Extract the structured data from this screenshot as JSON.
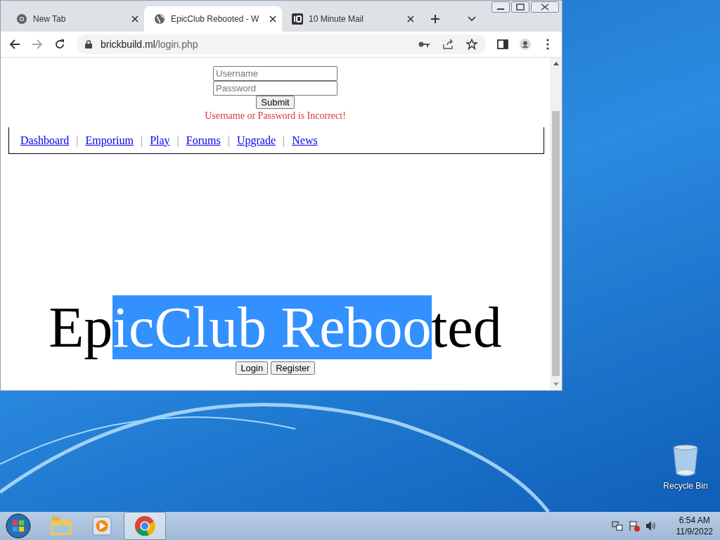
{
  "tabs": [
    {
      "title": "New Tab",
      "kind": "chrome",
      "selected": false
    },
    {
      "title": "EpicClub Rebooted - W",
      "kind": "globe",
      "selected": true
    },
    {
      "title": "10 Minute Mail",
      "kind": "ten",
      "selected": false
    }
  ],
  "address": {
    "host": "brickbuild.ml",
    "path": "/login.php"
  },
  "login_form": {
    "username_placeholder": "Username",
    "password_placeholder": "Password",
    "submit": "Submit",
    "error": "Username or Password is Incorrect!"
  },
  "nav_links": [
    "Dashboard",
    "Emporium",
    "Play",
    "Forums",
    "Upgrade",
    "News"
  ],
  "nav_separator": "|",
  "site_title": [
    {
      "text": "Ep",
      "selected": false
    },
    {
      "text": "icClub Reboo",
      "selected": true
    },
    {
      "text": "ted",
      "selected": false
    }
  ],
  "auth_buttons": [
    "Login",
    "Register"
  ],
  "desktop_icons": [
    {
      "label": "Recycle Bin"
    }
  ],
  "taskbar": {
    "time": "6:54 AM",
    "date": "11/9/2022"
  }
}
